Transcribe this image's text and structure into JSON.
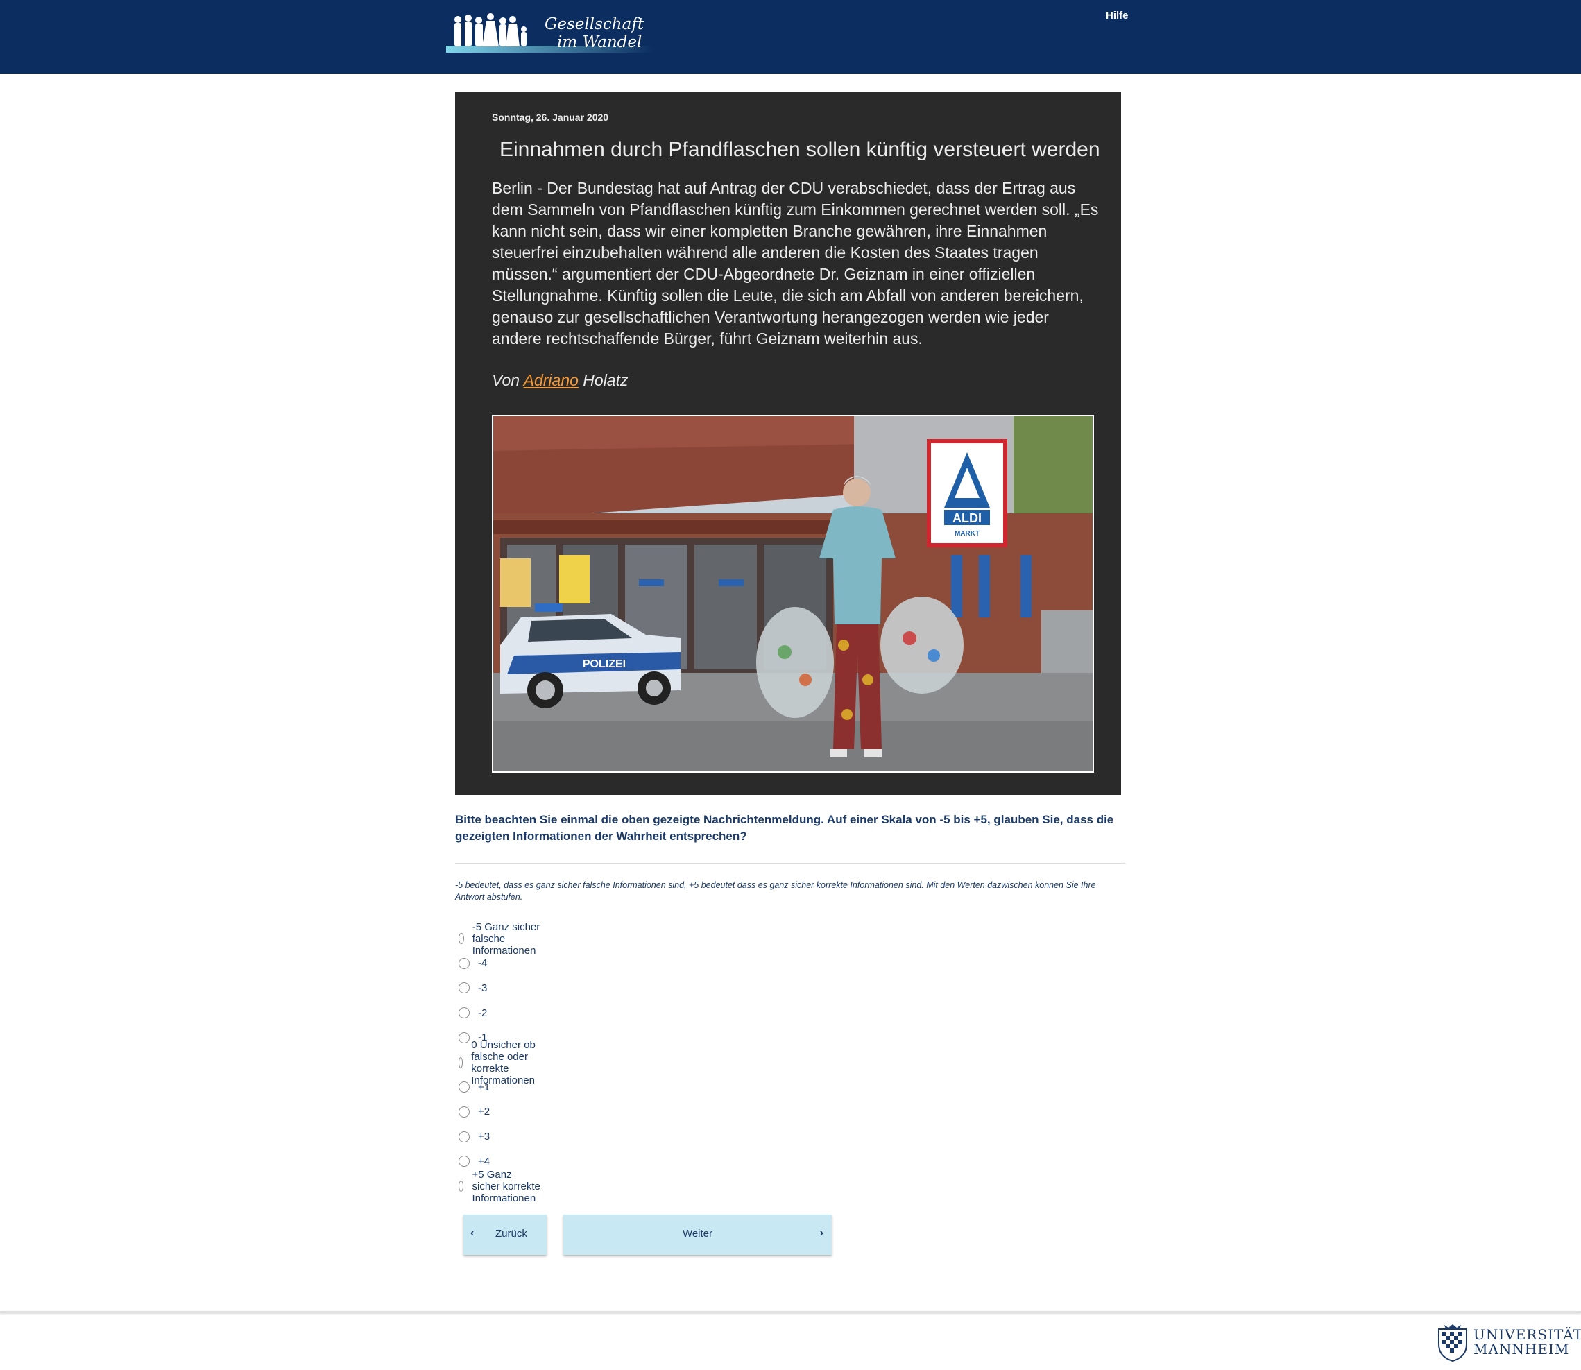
{
  "header": {
    "logo_line1": "Gesellschaft",
    "logo_line2": "im Wandel",
    "help_label": "Hilfe"
  },
  "news": {
    "date": "Sonntag, 26. Januar 2020",
    "headline": "Einnahmen durch Pfandflaschen sollen künftig versteuert werden",
    "body": "Berlin - Der Bundestag hat auf Antrag der CDU verabschiedet, dass der Ertrag aus dem Sammeln von Pfandflaschen künftig zum Einkommen gerechnet werden soll. „Es kann nicht sein, dass wir einer kompletten Branche gewähren, ihre Einnahmen steuerfrei einzubehalten während alle anderen die Kosten des Staates tragen müssen.“ argumentiert der CDU-Abgeordnete Dr. Geiznam in einer offiziellen Stellungnahme. Künftig sollen die Leute, die sich am Abfall von anderen bereichern, genauso zur gesellschaftlichen Verantwortung herangezogen werden wie jeder andere rechtschaffende Bürger, führt Geiznam weiterhin aus.",
    "author_prefix": "Von",
    "author_first": "Adriano",
    "author_last": "Holatz",
    "photo_sign_text": "ALDI",
    "photo_sign_sub": "MARKT",
    "photo_car_text": "POLIZEI"
  },
  "question": {
    "text": "Bitte beachten Sie einmal die oben gezeigte Nachrichtenmeldung. Auf einer Skala von -5 bis +5, glauben Sie, dass die gezeigten Informationen der Wahrheit entsprechen?",
    "hint": "-5 bedeutet, dass es ganz sicher falsche Informationen sind, +5 bedeutet dass es ganz sicher korrekte Informationen sind. Mit den Werten dazwischen können Sie Ihre Antwort abstufen."
  },
  "options": [
    {
      "label": "-5 Ganz sicher falsche Informationen",
      "selected": false
    },
    {
      "label": "-4",
      "selected": false
    },
    {
      "label": "-3",
      "selected": false
    },
    {
      "label": "-2",
      "selected": false
    },
    {
      "label": "-1",
      "selected": false
    },
    {
      "label": "0 Unsicher ob falsche oder korrekte Informationen",
      "selected": false
    },
    {
      "label": "+1",
      "selected": false
    },
    {
      "label": "+2",
      "selected": false
    },
    {
      "label": "+3",
      "selected": false
    },
    {
      "label": "+4",
      "selected": false
    },
    {
      "label": "+5 Ganz sicher korrekte Informationen",
      "selected": false
    }
  ],
  "nav": {
    "back_label": "Zurück",
    "next_label": "Weiter"
  },
  "footer": {
    "uni_line1": "UNIVERSITÄT",
    "uni_line2": "MANNHEIM"
  },
  "colors": {
    "header_bg": "#0b2d5f",
    "card_bg": "#2a2a2a",
    "link_orange": "#f39a3c",
    "text_navy": "#1c3a68",
    "button_bg": "#c8e8f3"
  }
}
